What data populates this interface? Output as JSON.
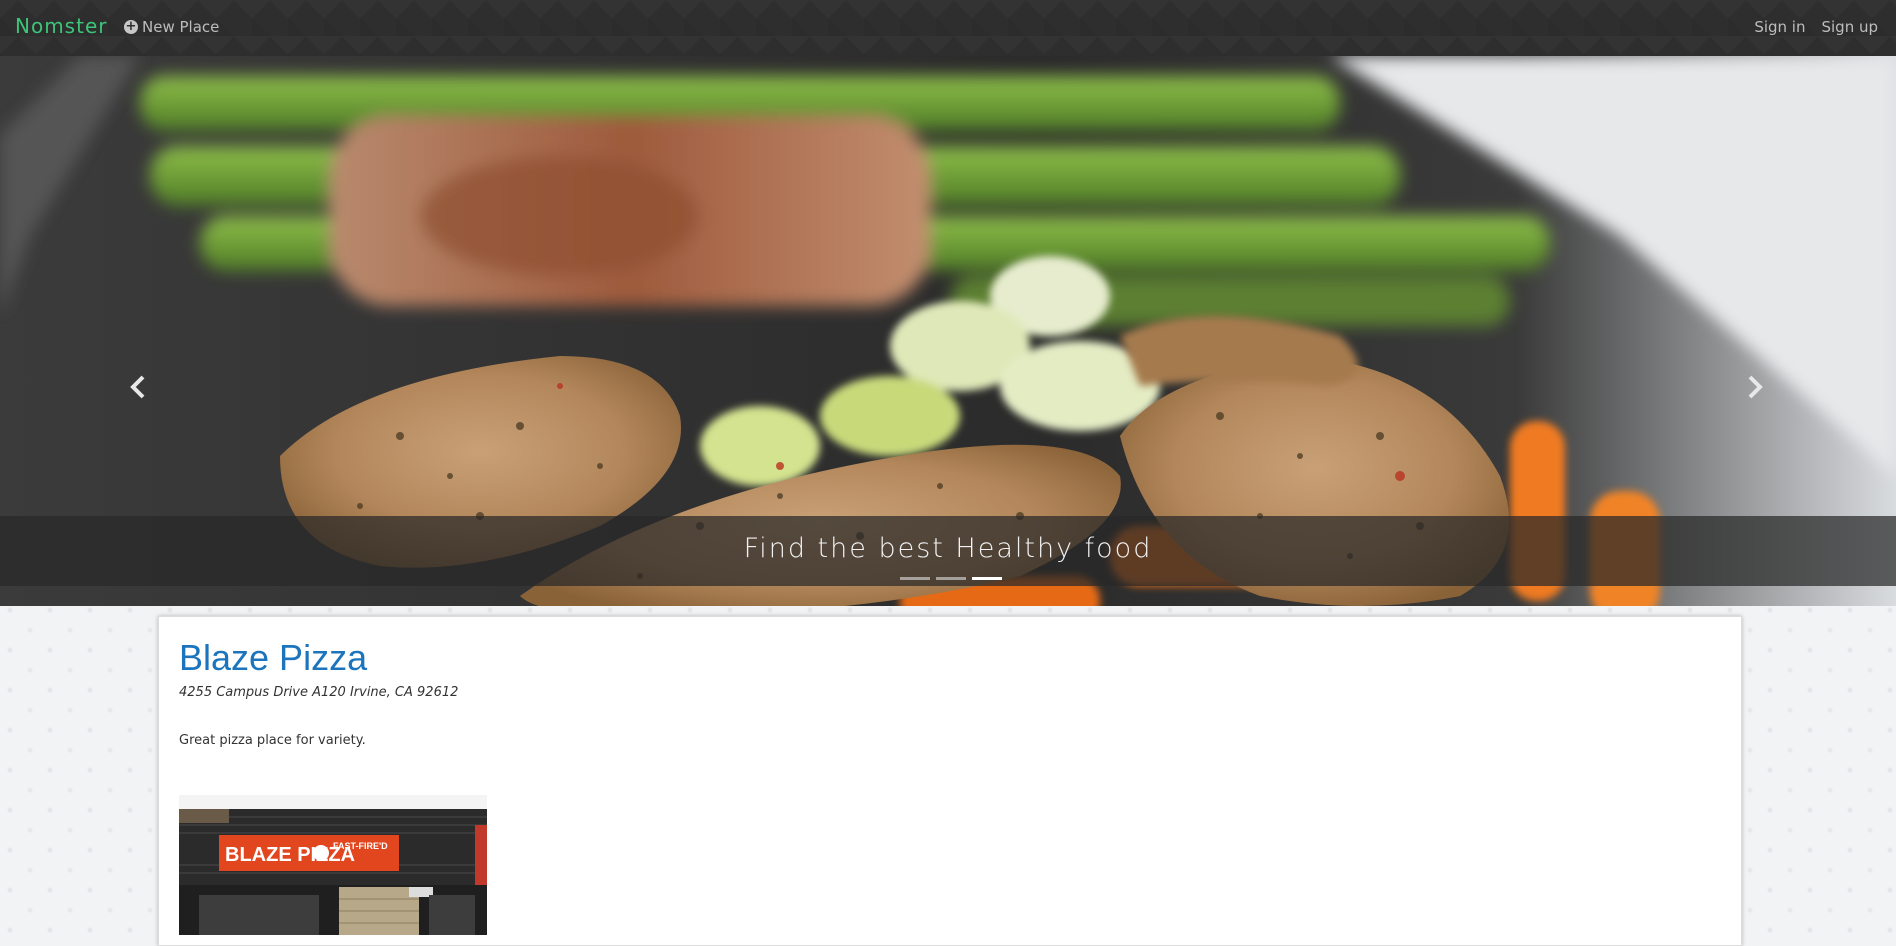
{
  "navbar": {
    "brand": "Nomster",
    "new_place_label": "New Place",
    "new_place_icon": "plus-circle-icon",
    "sign_in_label": "Sign in",
    "sign_up_label": "Sign up"
  },
  "carousel": {
    "caption": "Find the best Healthy food",
    "slide_count": 3,
    "active_slide": 3,
    "prev_icon": "chevron-left-icon",
    "next_icon": "chevron-right-icon"
  },
  "place": {
    "name": "Blaze Pizza",
    "address": "4255 Campus Drive A120 Irvine, CA 92612",
    "description": "Great pizza place for variety.",
    "photo_sign_text": "BLAZE PIZZA",
    "photo_sign_tagline": "FAST-FIRE'D"
  },
  "colors": {
    "brand": "#3cc579",
    "link": "#1c75bc",
    "navbar_bg": "#2e2e2e"
  }
}
